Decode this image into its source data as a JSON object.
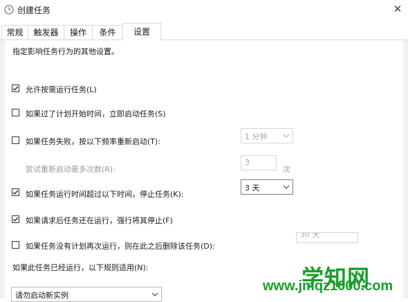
{
  "window": {
    "title": "创建任务",
    "close_glyph": "✕"
  },
  "tabs": [
    {
      "label": "常规"
    },
    {
      "label": "触发器"
    },
    {
      "label": "操作"
    },
    {
      "label": "条件"
    },
    {
      "label": "设置",
      "active": true
    }
  ],
  "settings": {
    "description": "指定影响任务行为的其他设置。",
    "allow_on_demand": {
      "label": "允许按需运行任务(L)",
      "checked": true
    },
    "run_asap_after_missed": {
      "label": "如果过了计划开始时间，立即启动任务(S)",
      "checked": false
    },
    "restart_on_failure": {
      "label": "如果任务失败，按以下频率重新启动(T):",
      "checked": false,
      "interval": "1 分钟"
    },
    "restart_attempts": {
      "label": "尝试重新启动最多次数(R):",
      "value": "3",
      "unit": "次"
    },
    "stop_if_runs_longer": {
      "label": "如果任务运行时间超过以下时间，停止任务(K):",
      "checked": true,
      "duration": "3 天"
    },
    "force_stop": {
      "label": "如果请求后任务还在运行，强行将其停止(F)",
      "checked": true
    },
    "delete_if_not_scheduled": {
      "label": "如果任务没有计划再次运行，则在此之后删除该任务(D):",
      "checked": false,
      "duration_partial": "30 天"
    },
    "rule_label": "如果此任务已经运行，以下规则适用(N):",
    "rule_value": "请勿启动新实例"
  },
  "watermark": {
    "title": "学知网",
    "url": "www.jmqz1000.com"
  },
  "colors": {
    "watermark": "#1a9e2a",
    "panel": "#f0f0f0",
    "tab_border": "#d9d9d9"
  }
}
